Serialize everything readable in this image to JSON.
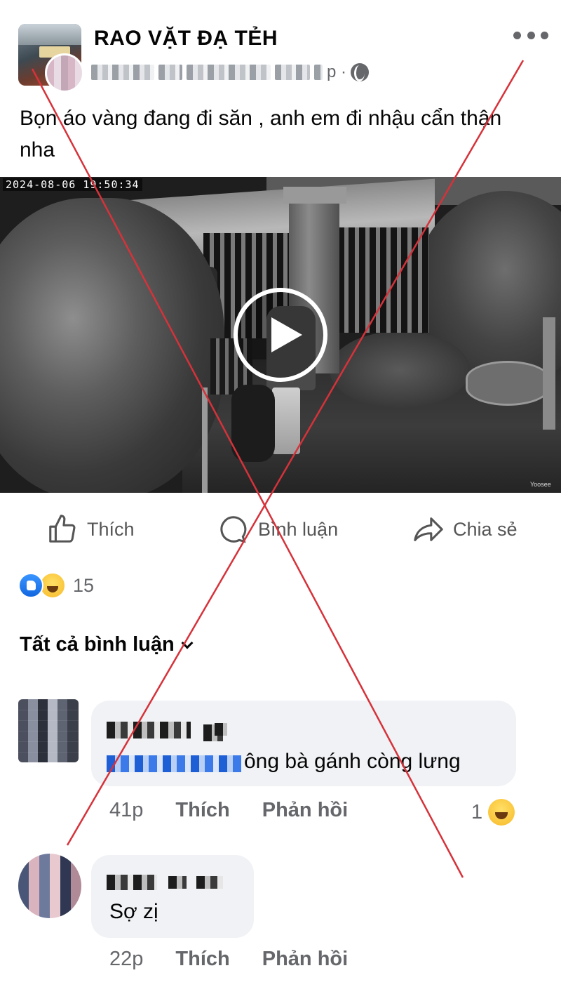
{
  "post": {
    "group_name": "RAO VẶT ĐẠ TẺH",
    "meta_suffix": "p ·",
    "text": "Bọn áo vàng đang đi săn , anh em đi nhậu cẩn thận nha",
    "more_icon": "more-horizontal-icon",
    "privacy_icon": "globe-icon"
  },
  "video": {
    "timestamp": "2024-08-06  19:50:34",
    "brand": "Yoosee",
    "play_icon": "play-icon"
  },
  "actions": {
    "like": "Thích",
    "comment": "Bình luận",
    "share": "Chia sẻ"
  },
  "reactions": {
    "count": "15",
    "icons": [
      "like-reaction-icon",
      "haha-reaction-icon"
    ]
  },
  "comments_filter": "Tất cả bình luận",
  "comments": [
    {
      "text": "ông bà gánh còng lưng",
      "time": "41p",
      "like": "Thích",
      "reply": "Phản hồi",
      "reaction_count": "1",
      "reaction_icon": "haha-reaction-icon"
    },
    {
      "text": "Sợ zị",
      "time": "22p",
      "like": "Thích",
      "reply": "Phản hồi"
    }
  ],
  "colors": {
    "overlay_x": "#d6323a",
    "meta_gray": "#65676b",
    "bubble": "#f0f2f5",
    "like_blue": "#1877f2"
  }
}
